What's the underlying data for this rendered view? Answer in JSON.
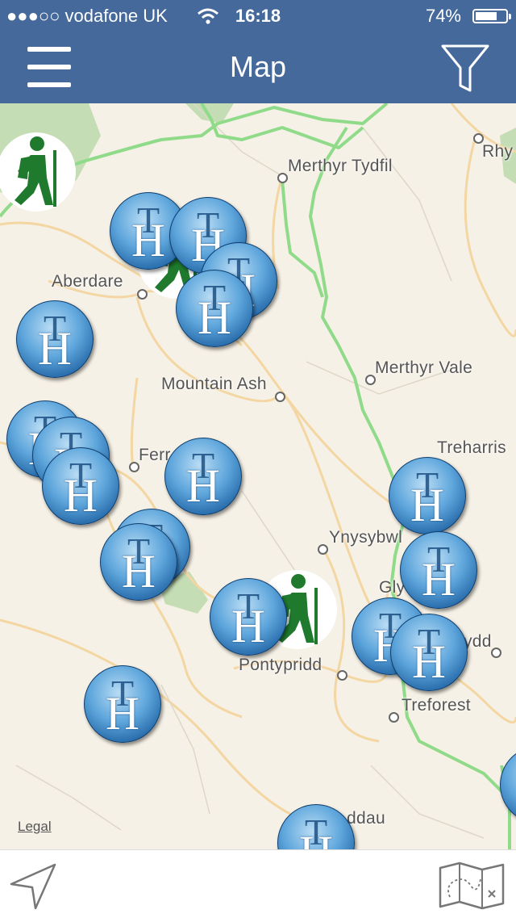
{
  "status_bar": {
    "carrier": "●●●○○ vodafone UK",
    "time": "16:18",
    "battery": "74%",
    "battery_level": 0.74,
    "signal_icon": "wifi-icon"
  },
  "nav_bar": {
    "title": "Map",
    "left_icon": "hamburger-menu-icon",
    "right_icon": "filter-funnel-icon"
  },
  "map": {
    "places": [
      {
        "name": "Merthyr Tydfil"
      },
      {
        "name": "Rhy"
      },
      {
        "name": "Aberdare"
      },
      {
        "name": "Mountain Ash"
      },
      {
        "name": "Merthyr Vale"
      },
      {
        "name": "Treharris"
      },
      {
        "name": "Ferr"
      },
      {
        "name": "Ynysybwl"
      },
      {
        "name": "Gly"
      },
      {
        "name": "ydd"
      },
      {
        "name": "Pontypridd"
      },
      {
        "name": "Treforest"
      },
      {
        "name": "ddau"
      }
    ],
    "hotel_marker": {
      "top_letter": "T",
      "main_letter": "H"
    },
    "hiking_marker": {
      "icon": "hiker-icon"
    },
    "legal": "Legal"
  },
  "bottom_bar": {
    "left_icon": "location-arrow-icon",
    "right_icon": "map-type-icon"
  },
  "colors": {
    "nav_bg": "#46699b",
    "map_bg": "#f6f1e6",
    "road_major": "#8fdb8a",
    "road_minor": "#f3d6a2",
    "park": "#c4ddb4",
    "hiker_green": "#1f7a2e"
  }
}
